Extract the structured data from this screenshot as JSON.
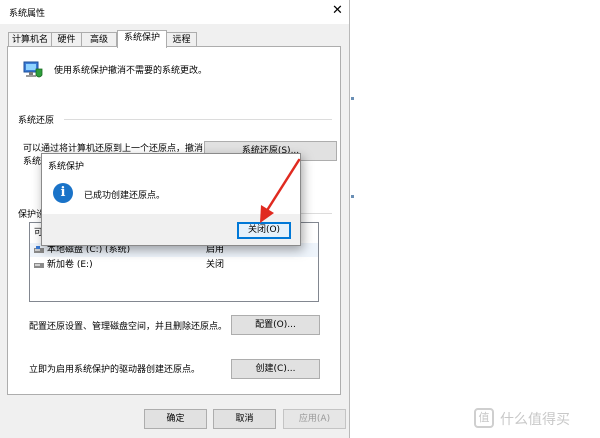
{
  "window": {
    "title": "系统属性",
    "tabs": [
      {
        "label": "计算机名",
        "active": false
      },
      {
        "label": "硬件",
        "active": false
      },
      {
        "label": "高级",
        "active": false
      },
      {
        "label": "系统保护",
        "active": true
      },
      {
        "label": "远程",
        "active": false
      }
    ],
    "close_glyph": "✕"
  },
  "protection": {
    "description": "使用系统保护撤消不需要的系统更改。",
    "restore_section": "系统还原",
    "restore_text_line1": "可以通过将计算机还原到上一个还原点，撤消",
    "restore_text_line2": "系统",
    "restore_button": "系统还原(S)...",
    "settings_section": "保护设",
    "list_header_visible": "可",
    "drives": [
      {
        "name": "本地磁盘 (C:) (系统)",
        "status": "启用",
        "icon": "system-drive-icon"
      },
      {
        "name": "新加卷 (E:)",
        "status": "关闭",
        "icon": "drive-icon"
      }
    ],
    "configure_text": "配置还原设置、管理磁盘空间，并且删除还原点。",
    "configure_button": "配置(O)...",
    "create_text": "立即为启用系统保护的驱动器创建还原点。",
    "create_button": "创建(C)..."
  },
  "footer": {
    "ok": "确定",
    "cancel": "取消",
    "apply": "应用(A)"
  },
  "popup": {
    "title": "系统保护",
    "message": "已成功创建还原点。",
    "close_button": "关闭(O)",
    "icon": "info-icon"
  },
  "watermark": {
    "text": "什么值得买",
    "logo_glyph": "值"
  },
  "colors": {
    "arrow": "#e02a20",
    "accent": "#0078d7",
    "info": "#1a73c8"
  }
}
